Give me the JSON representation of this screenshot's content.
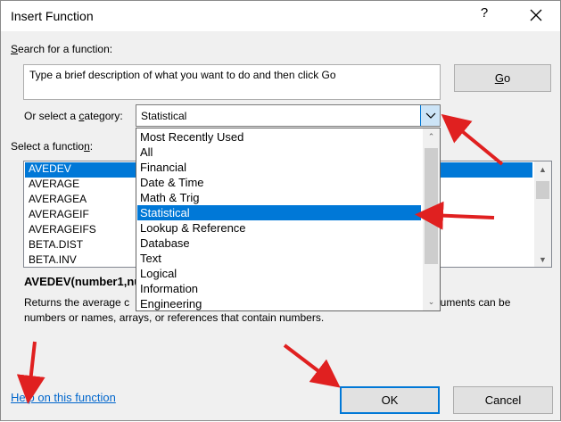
{
  "dialog": {
    "title": "Insert Function",
    "help_glyph": "?",
    "close_icon": "close-icon"
  },
  "search": {
    "label_pre": "",
    "label_u": "S",
    "label_post": "earch for a function:",
    "value": "Type a brief description of what you want to do and then click Go",
    "go_u": "G",
    "go_post": "o"
  },
  "category": {
    "label_pre": "Or select a ",
    "label_u": "c",
    "label_post": "ategory:",
    "selected": "Statistical",
    "options": [
      "Most Recently Used",
      "All",
      "Financial",
      "Date & Time",
      "Math & Trig",
      "Statistical",
      "Lookup & Reference",
      "Database",
      "Text",
      "Logical",
      "Information",
      "Engineering"
    ],
    "selected_index": 5
  },
  "functions": {
    "label_pre": "Select a functio",
    "label_u": "n",
    "label_post": ":",
    "items": [
      "AVEDEV",
      "AVERAGE",
      "AVERAGEA",
      "AVERAGEIF",
      "AVERAGEIFS",
      "BETA.DIST",
      "BETA.INV"
    ],
    "selected_index": 0
  },
  "details": {
    "signature": "AVEDEV(number1,nu",
    "desc_line1_left": "Returns the average c",
    "desc_line1_right": "Arguments can be",
    "desc_line2": "numbers or names, arrays, or references that contain numbers."
  },
  "footer": {
    "help_link": "Help on this function",
    "ok_label": "OK",
    "cancel_label": "Cancel"
  },
  "colors": {
    "accent": "#0078d7",
    "annotation_arrow": "#e02020"
  }
}
